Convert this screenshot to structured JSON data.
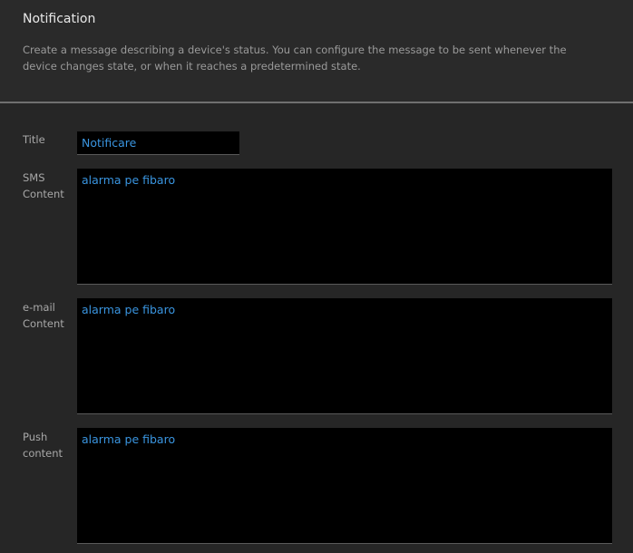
{
  "header": {
    "title": "Notification",
    "description": "Create a message describing a device's status. You can configure the message to be sent whenever the device changes state, or when it reaches a predetermined state."
  },
  "form": {
    "title": {
      "label": "Title",
      "value": "Notificare"
    },
    "sms": {
      "label_line1": "SMS",
      "label_line2": "Content",
      "value": "alarma pe fibaro"
    },
    "email": {
      "label_line1": "e-mail",
      "label_line2": "Content",
      "value": "alarma pe fibaro"
    },
    "push": {
      "label_line1": "Push",
      "label_line2": "content",
      "value": "alarma pe fibaro"
    }
  },
  "colors": {
    "background": "#262626",
    "field_background": "#000000",
    "field_text": "#3a95e0",
    "label_text": "#a8a8a8"
  }
}
